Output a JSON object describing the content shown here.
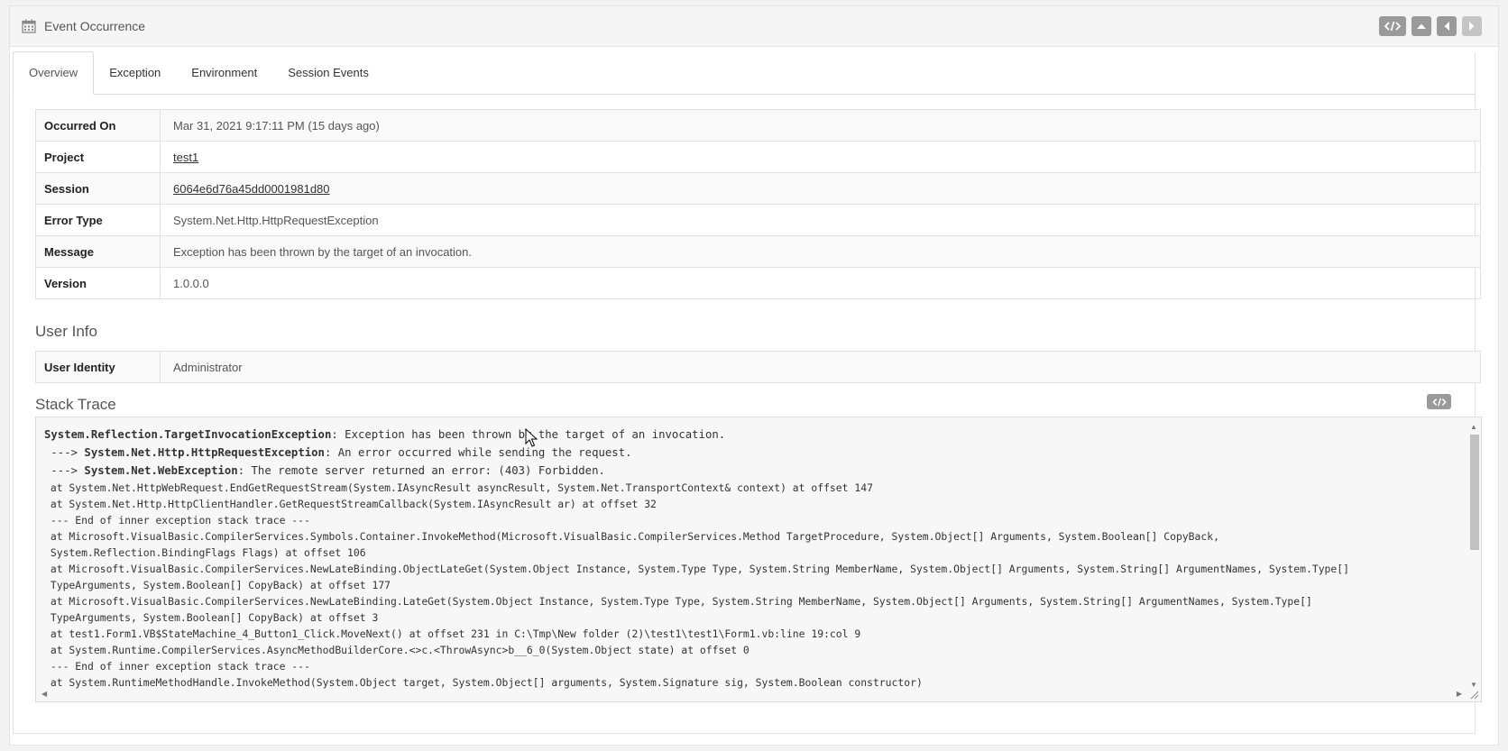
{
  "panel": {
    "title": "Event Occurrence",
    "icon": "calendar-icon",
    "header_buttons": [
      "code-icon",
      "chevron-up-icon",
      "chevron-left-icon",
      "chevron-right-icon"
    ]
  },
  "tabs": [
    {
      "label": "Overview",
      "active": true
    },
    {
      "label": "Exception",
      "active": false
    },
    {
      "label": "Environment",
      "active": false
    },
    {
      "label": "Session Events",
      "active": false
    }
  ],
  "overview": {
    "rows": [
      {
        "key": "Occurred On",
        "value": "Mar 31, 2021 9:17:11 PM (15 days ago)",
        "link": false
      },
      {
        "key": "Project",
        "value": "test1",
        "link": true
      },
      {
        "key": "Session",
        "value": "6064e6d76a45dd0001981d80",
        "link": true
      },
      {
        "key": "Error Type",
        "value": "System.Net.Http.HttpRequestException",
        "link": false
      },
      {
        "key": "Message",
        "value": "Exception has been thrown by the target of an invocation.",
        "link": false
      },
      {
        "key": "Version",
        "value": "1.0.0.0",
        "link": false
      }
    ]
  },
  "user_info": {
    "title": "User Info",
    "rows": [
      {
        "key": "User Identity",
        "value": "Administrator"
      }
    ]
  },
  "stack_trace": {
    "title": "Stack Trace",
    "lines": [
      {
        "prefix": "",
        "bold": "System.Reflection.TargetInvocationException",
        "rest": ": Exception has been thrown by the target of an invocation.",
        "big": true
      },
      {
        "prefix": " ---> ",
        "bold": "System.Net.Http.HttpRequestException",
        "rest": ": An error occurred while sending the request.",
        "big": true
      },
      {
        "prefix": " ---> ",
        "bold": "System.Net.WebException",
        "rest": ": The remote server returned an error: (403) Forbidden.",
        "big": true
      },
      {
        "prefix": "",
        "bold": "",
        "rest": " at System.Net.HttpWebRequest.EndGetRequestStream(System.IAsyncResult asyncResult, System.Net.TransportContext& context) at offset 147",
        "big": false
      },
      {
        "prefix": "",
        "bold": "",
        "rest": " at System.Net.Http.HttpClientHandler.GetRequestStreamCallback(System.IAsyncResult ar) at offset 32",
        "big": false
      },
      {
        "prefix": "",
        "bold": "",
        "rest": " --- End of inner exception stack trace ---",
        "big": false
      },
      {
        "prefix": "",
        "bold": "",
        "rest": " at Microsoft.VisualBasic.CompilerServices.Symbols.Container.InvokeMethod(Microsoft.VisualBasic.CompilerServices.Method TargetProcedure, System.Object[] Arguments, System.Boolean[] CopyBack,",
        "big": false
      },
      {
        "prefix": "",
        "bold": "",
        "rest": " System.Reflection.BindingFlags Flags) at offset 106",
        "big": false
      },
      {
        "prefix": "",
        "bold": "",
        "rest": " at Microsoft.VisualBasic.CompilerServices.NewLateBinding.ObjectLateGet(System.Object Instance, System.Type Type, System.String MemberName, System.Object[] Arguments, System.String[] ArgumentNames, System.Type[]",
        "big": false
      },
      {
        "prefix": "",
        "bold": "",
        "rest": " TypeArguments, System.Boolean[] CopyBack) at offset 177",
        "big": false
      },
      {
        "prefix": "",
        "bold": "",
        "rest": " at Microsoft.VisualBasic.CompilerServices.NewLateBinding.LateGet(System.Object Instance, System.Type Type, System.String MemberName, System.Object[] Arguments, System.String[] ArgumentNames, System.Type[]",
        "big": false
      },
      {
        "prefix": "",
        "bold": "",
        "rest": " TypeArguments, System.Boolean[] CopyBack) at offset 3",
        "big": false
      },
      {
        "prefix": "",
        "bold": "",
        "rest": " at test1.Form1.VB$StateMachine_4_Button1_Click.MoveNext() at offset 231 in C:\\Tmp\\New folder (2)\\test1\\test1\\Form1.vb:line 19:col 9",
        "big": false
      },
      {
        "prefix": "",
        "bold": "",
        "rest": " at System.Runtime.CompilerServices.AsyncMethodBuilderCore.<>c.<ThrowAsync>b__6_0(System.Object state) at offset 0",
        "big": false
      },
      {
        "prefix": "",
        "bold": "",
        "rest": " --- End of inner exception stack trace ---",
        "big": false
      },
      {
        "prefix": "",
        "bold": "",
        "rest": " at System.RuntimeMethodHandle.InvokeMethod(System.Object target, System.Object[] arguments, System.Signature sig, System.Boolean constructor)",
        "big": false
      }
    ]
  }
}
